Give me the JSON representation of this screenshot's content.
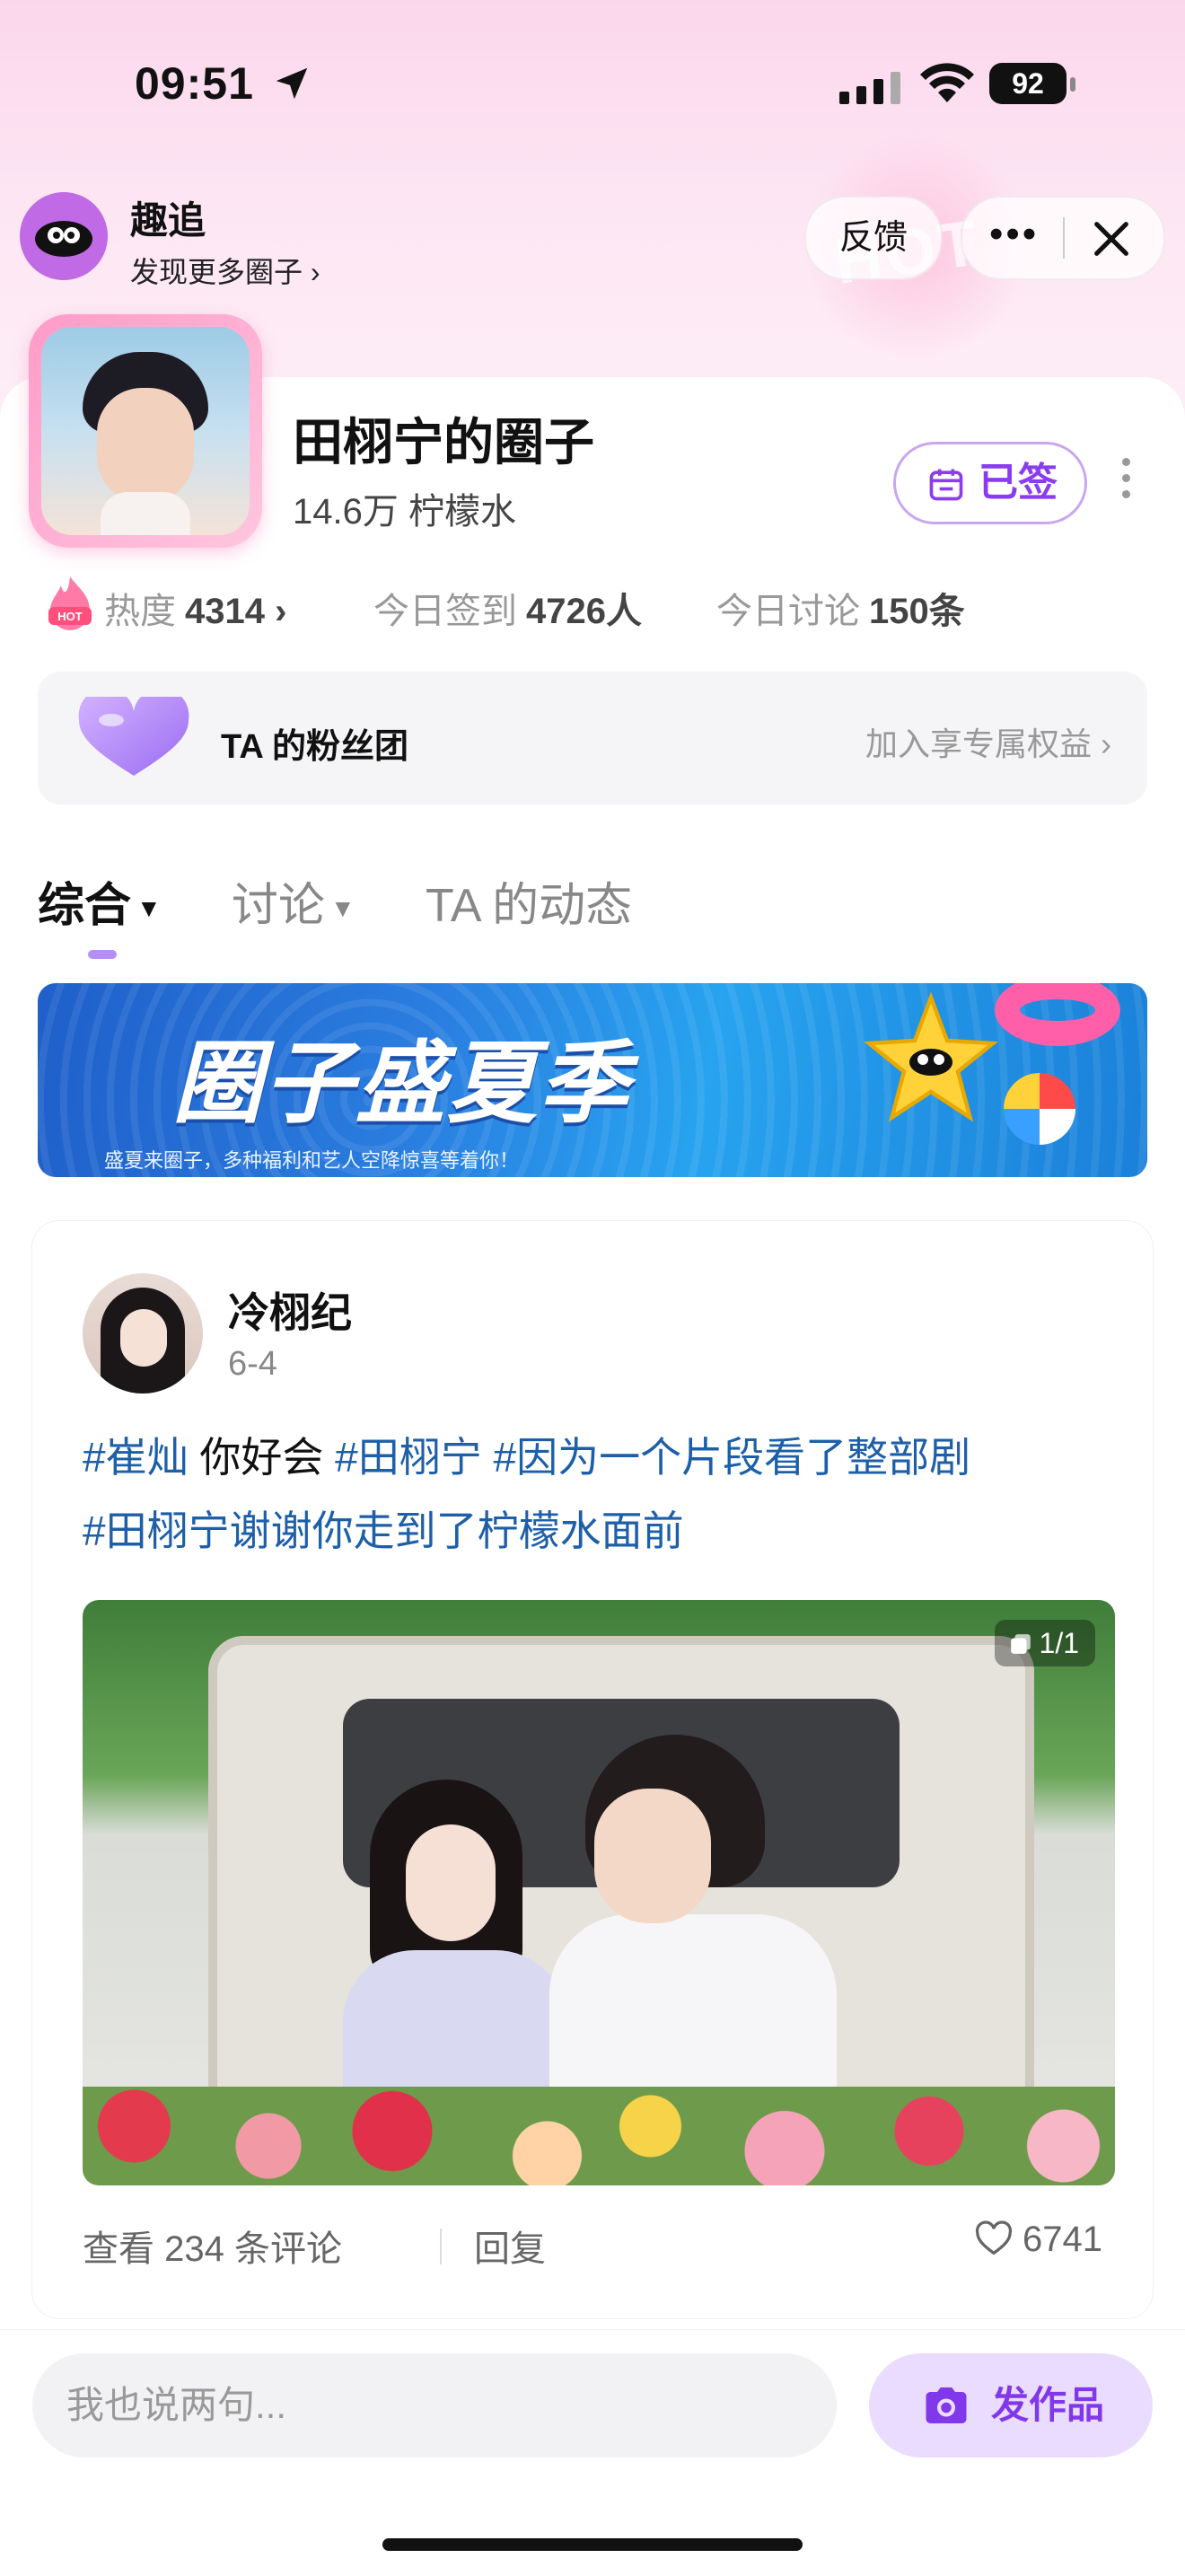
{
  "status_bar": {
    "time": "09:51",
    "battery": "92"
  },
  "mini_app": {
    "name": "趣追",
    "subtitle": "发现更多圈子 ›",
    "feedback_label": "反馈",
    "more_label": "•••"
  },
  "circle": {
    "title": "田栩宁的圈子",
    "members": "14.6万 柠檬水",
    "signed_label": "已签",
    "hot_badge": "HOT",
    "stats": {
      "heat_label": "热度",
      "heat_value": "4314 ›",
      "checkin_label": "今日签到",
      "checkin_value": "4726人",
      "discuss_label": "今日讨论",
      "discuss_value": "150条"
    },
    "fan_club": {
      "label": "TA 的粉丝团",
      "cta": "加入享专属权益 ›"
    }
  },
  "tabs": [
    {
      "label": "综合",
      "active": true
    },
    {
      "label": "讨论",
      "active": false
    },
    {
      "label": "TA 的动态",
      "active": false
    }
  ],
  "banner": {
    "title": "圈子盛夏季",
    "subtitle": "盛夏来圈子，多种福利和艺人空降惊喜等着你！"
  },
  "post": {
    "author": "冷栩纪",
    "date": "6-4",
    "text_parts": [
      "#崔灿",
      " 你好会 ",
      "#田栩宁",
      " ",
      "#因为一个片段看了整部剧",
      " ",
      "#田栩宁谢谢你走到了柠檬水面前"
    ],
    "image_counter": "1/1",
    "view_comments": "查看 234 条评论",
    "reply": "回复",
    "likes": "6741"
  },
  "bottom_bar": {
    "input_placeholder": "我也说两句...",
    "post_button": "发作品"
  },
  "colors": {
    "accent_purple": "#8a3df0",
    "hashtag_blue": "#1d5fa8",
    "header_pink": "#fbd7ec"
  }
}
